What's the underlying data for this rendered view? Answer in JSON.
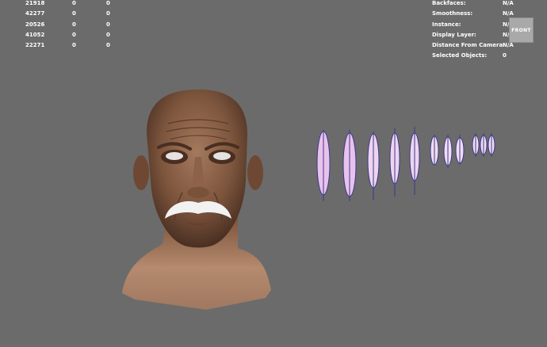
{
  "stats_table": {
    "rows": [
      [
        "21918",
        "0",
        "0"
      ],
      [
        "42277",
        "0",
        "0"
      ],
      [
        "20526",
        "0",
        "0"
      ],
      [
        "41052",
        "0",
        "0"
      ],
      [
        "22271",
        "0",
        "0"
      ]
    ]
  },
  "object_info": [
    {
      "label": "Backfaces:",
      "value": "N/A"
    },
    {
      "label": "Smoothness:",
      "value": "N/A"
    },
    {
      "label": "Instance:",
      "value": "N/A"
    },
    {
      "label": "Display Layer:",
      "value": "N/A"
    },
    {
      "label": "Distance From Camera:",
      "value": "N/A"
    },
    {
      "label": "Selected Objects:",
      "value": "0"
    }
  ],
  "view_cube": {
    "label": "FRONT"
  },
  "colors": {
    "viewport_bg": "#6b6b6b",
    "hud_text": "#ffffff",
    "skin": "#8a5f45",
    "mustache": "#f2f2f2",
    "hair_strand": "#e9c2ec",
    "hair_guide": "#3a3a8a"
  }
}
